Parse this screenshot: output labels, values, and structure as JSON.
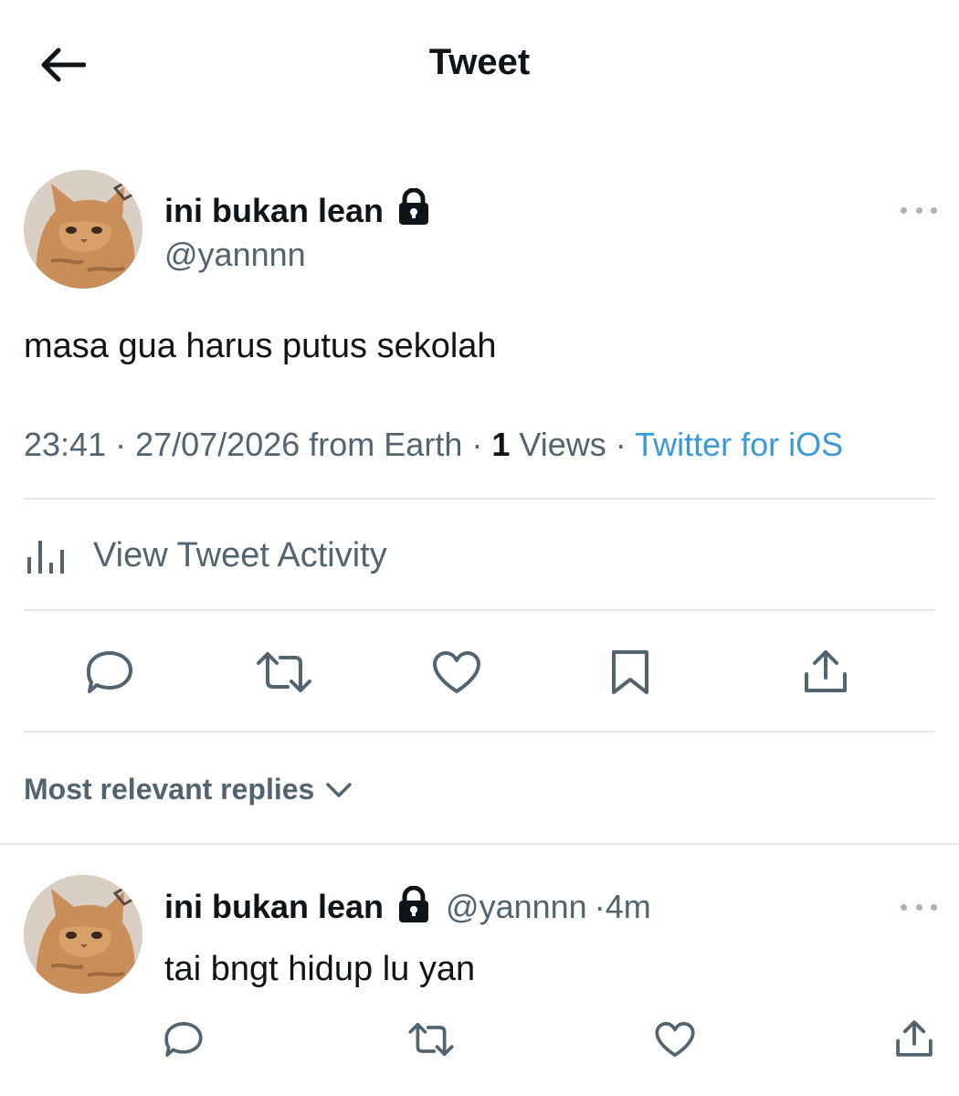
{
  "header": {
    "title": "Tweet"
  },
  "tweet": {
    "display_name": "ini bukan lean",
    "handle": "@yannnn",
    "text": "masa gua harus putus sekolah",
    "time": "23:41",
    "date": "27/07/2026",
    "location": "from Earth",
    "views_count": "1",
    "views_label": "Views",
    "source": "Twitter for iOS",
    "separator": " · "
  },
  "activity": {
    "label": "View Tweet Activity"
  },
  "replies": {
    "sort_label": "Most relevant replies",
    "items": [
      {
        "display_name": "ini bukan lean",
        "handle": "@yannnn",
        "time": "4m",
        "text": "tai bngt hidup lu yan"
      }
    ]
  },
  "icons": {
    "back": "arrow-left-icon",
    "lock": "lock-icon",
    "more": "more-horizontal-icon",
    "activity": "bar-chart-icon",
    "reply": "reply-icon",
    "retweet": "retweet-icon",
    "like": "heart-icon",
    "bookmark": "bookmark-icon",
    "share": "share-icon",
    "chevron": "chevron-down-icon"
  },
  "colors": {
    "text": "#0f1419",
    "muted": "#536471",
    "link": "#3a9ad9",
    "divider": "#e3e6e8"
  }
}
